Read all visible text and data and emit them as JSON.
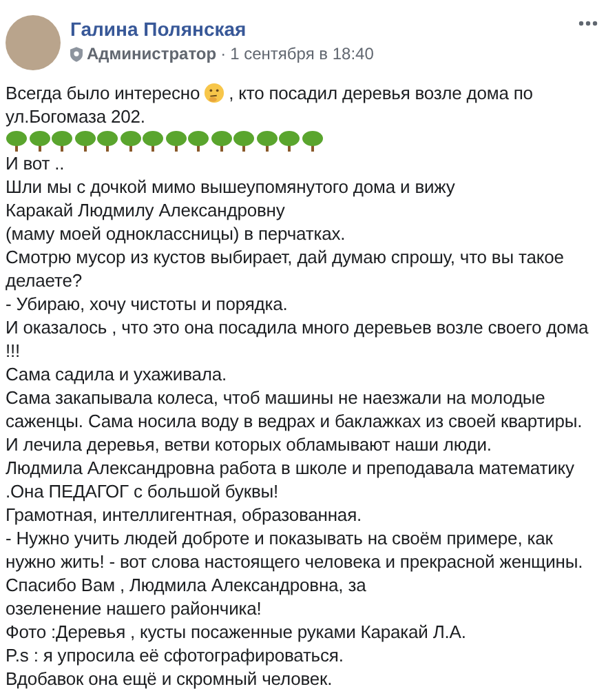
{
  "post": {
    "author": "Галина Полянская",
    "role": "Администратор",
    "separator": "·",
    "time": "1 сентября в 18:40",
    "intro": {
      "before": "Всегда было интересно",
      "after": ", кто посадил деревья возле дома по"
    },
    "lines_before_trees": [
      "ул.Богомаза 202."
    ],
    "lines": [
      "И вот ..",
      "Шли мы с дочкой мимо вышеупомянутого дома и вижу",
      "Каракай Людмилу Александровну",
      "(маму моей одноклассницы) в перчатках.",
      "Смотрю мусор из кустов выбирает, дай думаю спрошу, что вы такое",
      "делаете?",
      "- Убираю, хочу чистоты и порядка.",
      "И оказалось , что это она посадила много деревьев возле своего дома",
      "!!!",
      "Сама садила и ухаживала.",
      "Сама закапывала колеса, чтоб машины не наезжали на молодые",
      "саженцы. Сама носила воду в ведрах и баклажках из своей квартиры.",
      "И лечила деревья, ветви которых обламывают наши люди.",
      "Людмила Александровна работа в школе и преподавала математику",
      ".Она ПЕДАГОГ с большой буквы!",
      "Грамотная, интеллигентная, образованная.",
      "- Нужно учить людей доброте и показывать на своём примере, как",
      "нужно жить! - вот слова настоящего человека и прекрасной женщины.",
      "Спасибо Вам , Людмила Александровна, за",
      "озеленение нашего райончика!",
      "Фото :Деревья , кусты посаженные руками Каракай Л.А.",
      "P.s : я упросила её сфотографироваться.",
      "Вдобавок она ещё и скромный человек."
    ]
  }
}
